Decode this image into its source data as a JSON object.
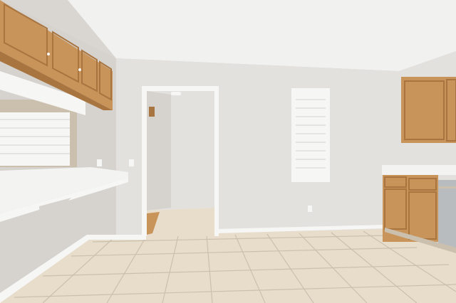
{
  "scene": {
    "subject": "empty-kitchen-dining-area",
    "palette": {
      "ceiling": "#f1f1ef",
      "wall": "#e3e1de",
      "wall_shade": "#d6d3cf",
      "floor": "#e8dccb",
      "grout": "#cbbfae",
      "cabinet": "#c8945a",
      "cabinet_dark": "#a8743f",
      "counter": "#f3f3f1",
      "trim": "#f6f6f4",
      "steel": "#b9bcbf"
    }
  }
}
